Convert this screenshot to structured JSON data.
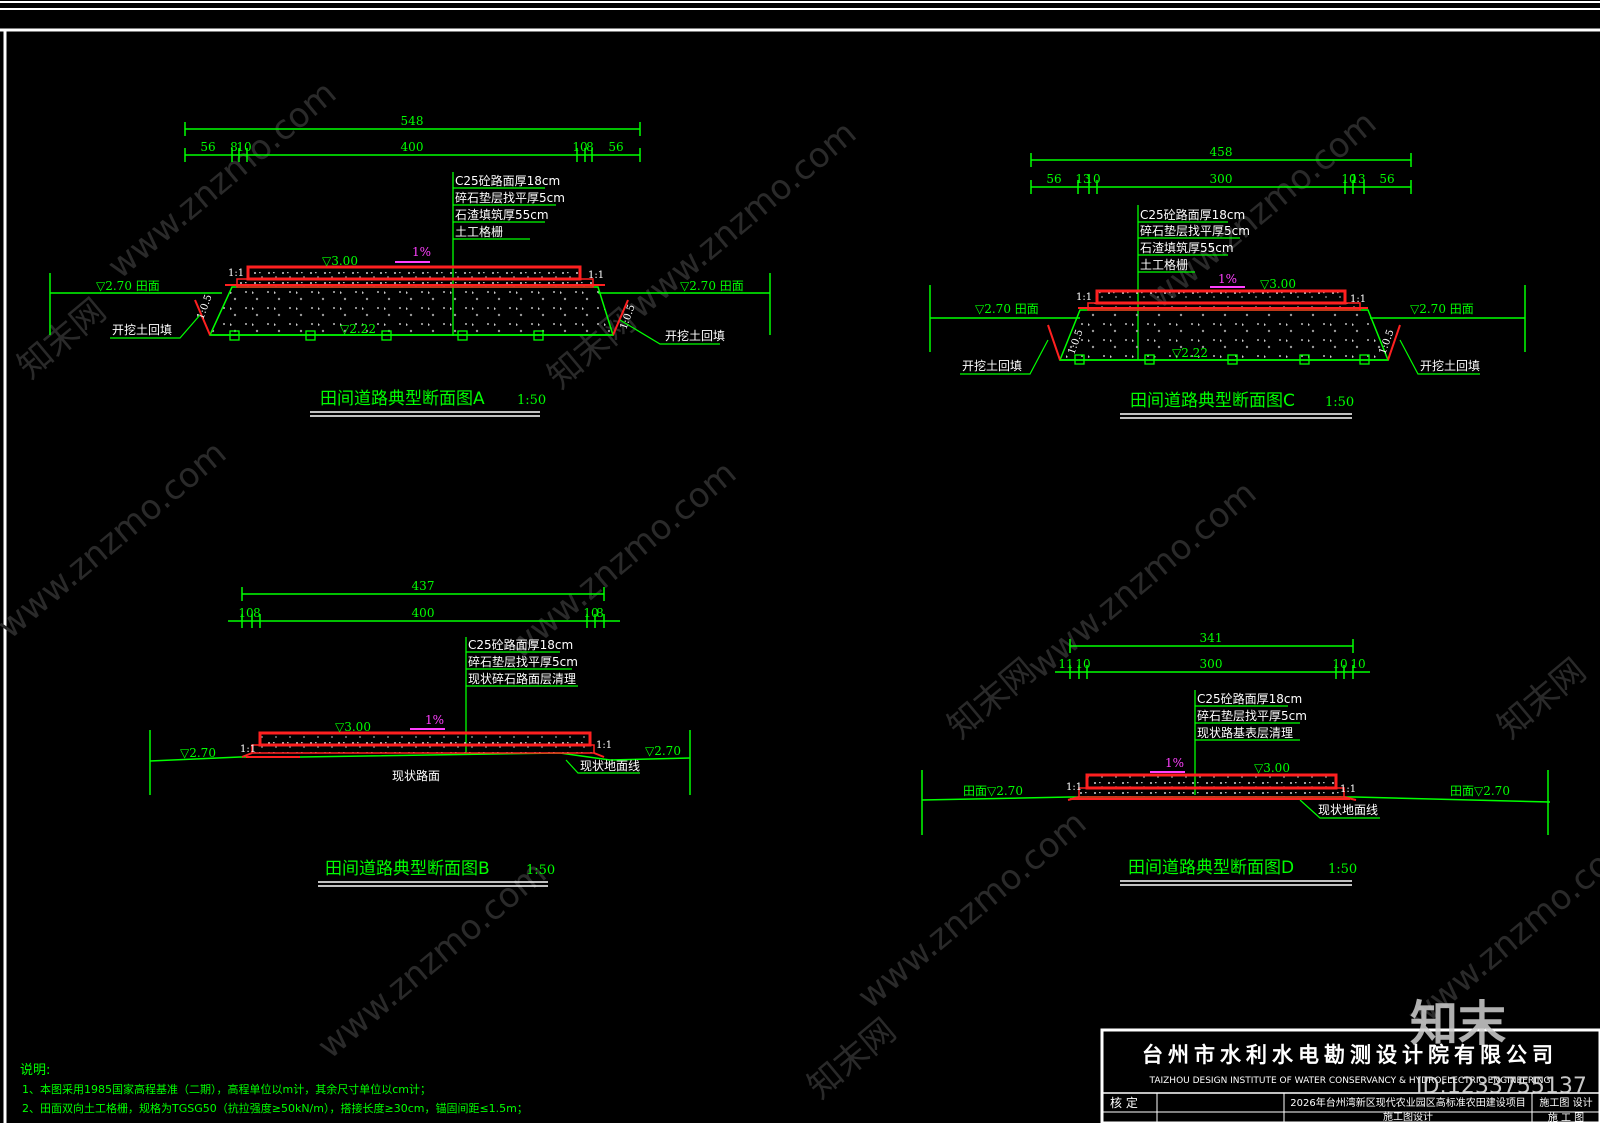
{
  "colors": {
    "background": "#000000",
    "line_green": "#00ff00",
    "pavement_red": "#ff2020",
    "label_white": "#ffffff",
    "title_green": "#00ff00",
    "slope_magenta": "#ff40ff",
    "ground_cyan": "#40e0e0",
    "frame_white": "#ffffff"
  },
  "sections": [
    {
      "id": "A",
      "title": "田间道路典型断面图A",
      "scale": "1:50",
      "dim_total": "548",
      "dim_parts": [
        "56",
        "8",
        "10",
        "400",
        "10",
        "8",
        "56"
      ],
      "layers": [
        "C25砼路面厚18cm",
        "碎石垫层找平厚5cm",
        "石渣填筑厚55cm",
        "土工格栅"
      ],
      "elev_top": "▽3.00",
      "elev_left": "▽2.70 田面",
      "elev_right": "▽2.70 田面",
      "elev_bottom": "▽2.22",
      "crossfall": "1%",
      "slope_top_left": "1:1",
      "slope_top_right": "1:1",
      "slope_side_left": "1:0.5",
      "slope_side_right": "1:0.5",
      "note_left": "开挖土回填",
      "note_right": "开挖土回填"
    },
    {
      "id": "C",
      "title": "田间道路典型断面图C",
      "scale": "1:50",
      "dim_total": "458",
      "dim_parts": [
        "56",
        "13",
        "10",
        "300",
        "10",
        "13",
        "56"
      ],
      "layers": [
        "C25砼路面厚18cm",
        "碎石垫层找平厚5cm",
        "石渣填筑厚55cm",
        "土工格栅"
      ],
      "elev_top": "▽3.00",
      "elev_left": "▽2.70 田面",
      "elev_right": "▽2.70 田面",
      "elev_bottom": "▽2.22",
      "crossfall": "1%",
      "slope_top_left": "1:1",
      "slope_top_right": "1:1",
      "slope_side_left": "1:0.5",
      "slope_side_right": "1:0.5",
      "note_left": "开挖土回填",
      "note_right": "开挖土回填"
    },
    {
      "id": "B",
      "title": "田间道路典型断面图B",
      "scale": "1:50",
      "dim_total": "437",
      "dim_parts": [
        "10",
        "8",
        "400",
        "10",
        "8"
      ],
      "layers": [
        "C25砼路面厚18cm",
        "碎石垫层找平厚5cm",
        "现状碎石路面层清理"
      ],
      "elev_top": "▽3.00",
      "elev_left": "▽2.70",
      "elev_right": "▽2.70",
      "crossfall": "1%",
      "slope_top_left": "1:1",
      "slope_top_right": "1:1",
      "note_bottom": "现状路面",
      "note_right": "现状地面线"
    },
    {
      "id": "D",
      "title": "田间道路典型断面图D",
      "scale": "1:50",
      "dim_total": "341",
      "dim_parts": [
        "11",
        "10",
        "300",
        "10",
        "10"
      ],
      "layers": [
        "C25砼路面厚18cm",
        "碎石垫层找平厚5cm",
        "现状路基表层清理"
      ],
      "elev_top": "▽3.00",
      "elev_left": "田面▽2.70",
      "elev_right": "田面▽2.70",
      "crossfall": "1%",
      "slope_top_left": "1:1",
      "slope_top_right": "1:1",
      "note_right": "现状地面线"
    }
  ],
  "notes": {
    "heading": "说明:",
    "lines": [
      "1、本图采用1985国家高程基准（二期），高程单位以m计，其余尺寸单位以cm计；",
      "2、田面双向土工格栅，规格为TGSG50（抗拉强度≥50kN/m），搭接长度≥30cm，锚固间距≤1.5m；"
    ]
  },
  "title_block": {
    "company_cn": "台州市水利水电勘测设计院有限公司",
    "company_en": "TAIZHOU DESIGN INSTITUTE OF WATER CONSERVANCY & HYDROELECTRIC ENGINEERING",
    "row_label": "核  定",
    "project": "2026年台州湾新区现代农业园区高标准农田建设项目",
    "project_line2": "施工图设计",
    "stage_label": "施工图 设计",
    "stage_value": "施 工 图"
  },
  "watermark": {
    "site": "www.znzmo.com",
    "brand": "知末网",
    "logo": "知末",
    "id_text": "ID:1233755137"
  }
}
